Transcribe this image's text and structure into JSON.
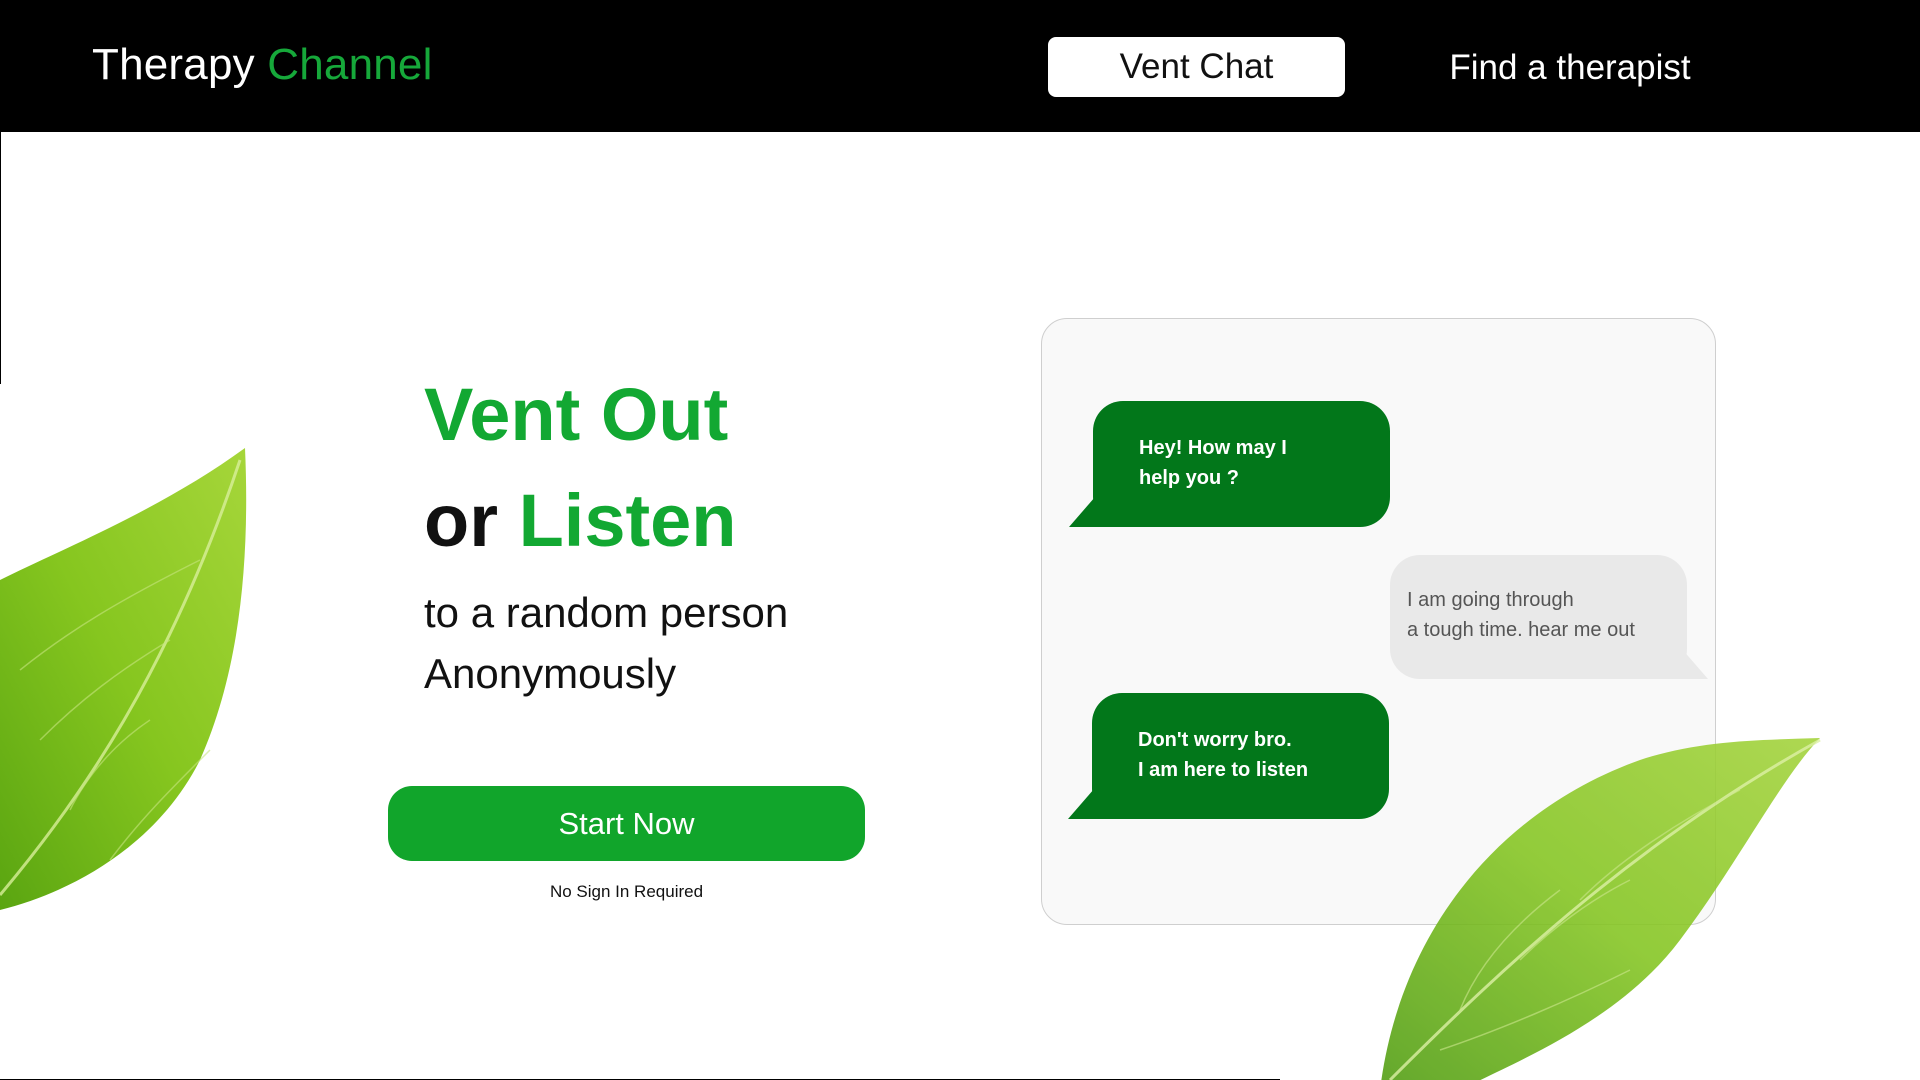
{
  "header": {
    "brand_part1": "Therapy",
    "brand_part2": "Channel",
    "nav": {
      "vent_chat": "Vent Chat",
      "find_therapist": "Find a therapist"
    }
  },
  "hero": {
    "line1": "Vent Out",
    "line2_or": "or",
    "line2_listen": "Listen",
    "sub_line1": "to a random person",
    "sub_line2": "Anonymously",
    "start_button": "Start Now",
    "note": "No Sign In Required"
  },
  "chat": {
    "messages": [
      {
        "side": "left",
        "line1": "Hey! How may I",
        "line2": "help you ?"
      },
      {
        "side": "right",
        "line1": "I am going through",
        "line2": "a tough time. hear me out"
      },
      {
        "side": "left",
        "line1": "Don't worry bro.",
        "line2": "I am here to listen"
      }
    ]
  },
  "colors": {
    "header_bg": "#000000",
    "brand_green": "#16a83a",
    "headline_green": "#12a832",
    "button_green": "#11a52b",
    "bubble_green": "#02771a",
    "bubble_gray": "#e9e9e9",
    "leaf_green": "#7cc21e"
  },
  "icons": [
    "leaf-image-left",
    "leaf-image-right"
  ]
}
